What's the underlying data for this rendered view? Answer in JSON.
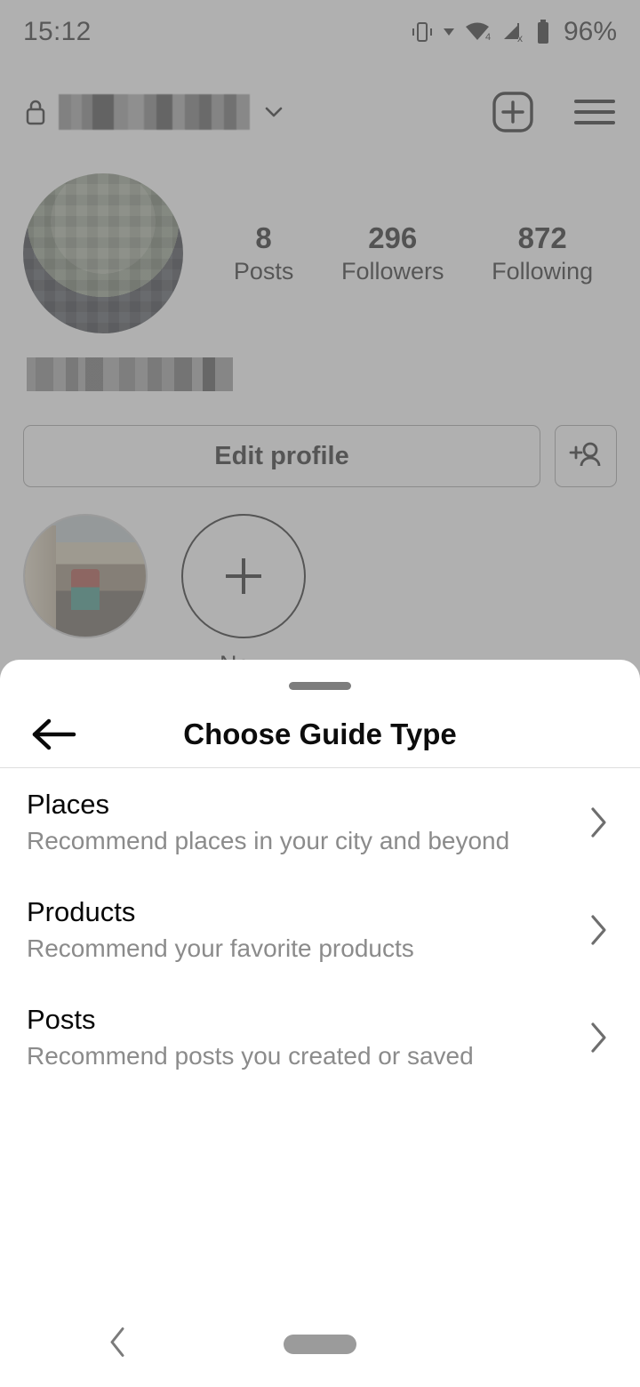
{
  "status_bar": {
    "time": "15:12",
    "battery_percent": "96%",
    "icons": [
      "vibrate-icon",
      "dropdown-triangle-icon",
      "wifi-icon",
      "cellular-no-sim-icon",
      "battery-icon"
    ],
    "wifi_badge": "4"
  },
  "profile": {
    "header": {
      "lock_icon": "lock-icon",
      "username_redacted": "",
      "chevron_down_icon": "chevron-down-icon",
      "new_post_icon": "plus-box-icon",
      "menu_icon": "hamburger-menu-icon"
    },
    "avatar": "profile-avatar",
    "stats": [
      {
        "value": "8",
        "label": "Posts"
      },
      {
        "value": "296",
        "label": "Followers"
      },
      {
        "value": "872",
        "label": "Following"
      }
    ],
    "bio_redacted": "",
    "edit_profile_label": "Edit profile",
    "add_person_icon": "add-person-icon",
    "highlights": [
      {
        "label": "",
        "type": "photo"
      },
      {
        "label": "New",
        "type": "new"
      }
    ]
  },
  "sheet": {
    "title": "Choose Guide Type",
    "back_icon": "arrow-left-icon",
    "drag_handle": "drag-handle",
    "items": [
      {
        "title": "Places",
        "subtitle": "Recommend places in your city and beyond",
        "chevron": "chevron-right-icon"
      },
      {
        "title": "Products",
        "subtitle": "Recommend your favorite products",
        "chevron": "chevron-right-icon"
      },
      {
        "title": "Posts",
        "subtitle": "Recommend posts you created or saved",
        "chevron": "chevron-right-icon"
      }
    ]
  },
  "nav_bar": {
    "back_icon": "nav-back-icon",
    "home_pill": "nav-home-pill"
  },
  "colors": {
    "sheet_background": "#ffffff",
    "overlay": "#808080",
    "title_text": "#0c0c0c",
    "subtitle_text": "#8b8b8b",
    "divider": "#dedede",
    "handle": "#7d7d7d"
  }
}
